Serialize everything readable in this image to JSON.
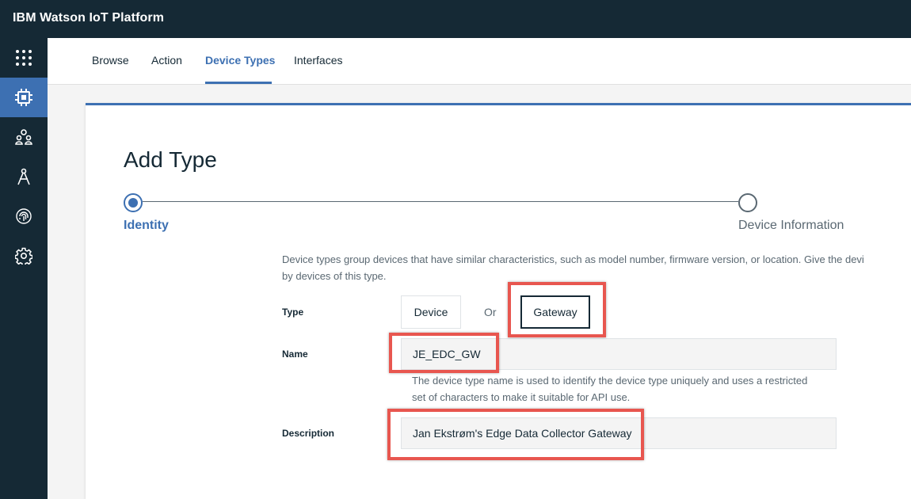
{
  "app": {
    "title": "IBM Watson IoT Platform"
  },
  "sidebar": {
    "items": [
      {
        "icon": "app-grid-icon",
        "active": false
      },
      {
        "icon": "devices-chip-icon",
        "active": true
      },
      {
        "icon": "members-icon",
        "active": false
      },
      {
        "icon": "apps-compass-icon",
        "active": false
      },
      {
        "icon": "security-fingerprint-icon",
        "active": false
      },
      {
        "icon": "settings-gear-icon",
        "active": false
      }
    ]
  },
  "tabs": [
    {
      "label": "Browse",
      "active": false
    },
    {
      "label": "Action",
      "active": false
    },
    {
      "label": "Device Types",
      "active": true
    },
    {
      "label": "Interfaces",
      "active": false
    }
  ],
  "page": {
    "heading": "Add Type"
  },
  "steps": [
    {
      "label": "Identity",
      "active": true
    },
    {
      "label": "Device Information",
      "active": false
    }
  ],
  "form": {
    "intro_line1": "Device types group devices that have similar characteristics, such as model number, firmware version, or location. Give the devi",
    "intro_line2": "by devices of this type.",
    "type_label": "Type",
    "device_option": "Device",
    "or_text": "Or",
    "gateway_option": "Gateway",
    "selected_type": "Gateway",
    "name_label": "Name",
    "name_value": "JE_EDC_GW",
    "name_help": "The device type name is used to identify the device type uniquely and uses a restricted set of characters to make it suitable for API use.",
    "description_label": "Description",
    "description_value": "Jan Ekstrøm's Edge Data Collector Gateway"
  },
  "colors": {
    "nav_bg": "#152935",
    "accent": "#3d70b2",
    "highlight": "#e8564f"
  }
}
